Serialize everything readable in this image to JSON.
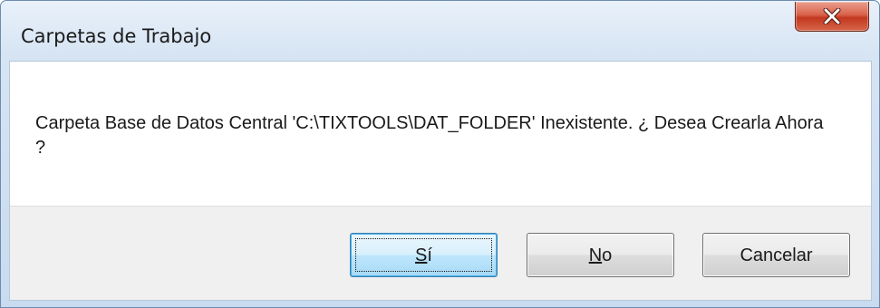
{
  "window": {
    "title": "Carpetas de Trabajo"
  },
  "titlebar": {
    "close_icon": "close-x-icon"
  },
  "message": {
    "text": "Carpeta Base de Datos Central 'C:\\TIXTOOLS\\DAT_FOLDER' Inexistente. ¿ Desea Crearla Ahora ?"
  },
  "buttons": {
    "yes": {
      "mnemonic": "S",
      "rest": "í"
    },
    "no": {
      "mnemonic": "N",
      "rest": "o"
    },
    "cancel": {
      "label": "Cancelar"
    }
  },
  "colors": {
    "close_button": "#c7432a",
    "default_button_border": "#3c7fb1",
    "frame": "#c9dbef"
  }
}
